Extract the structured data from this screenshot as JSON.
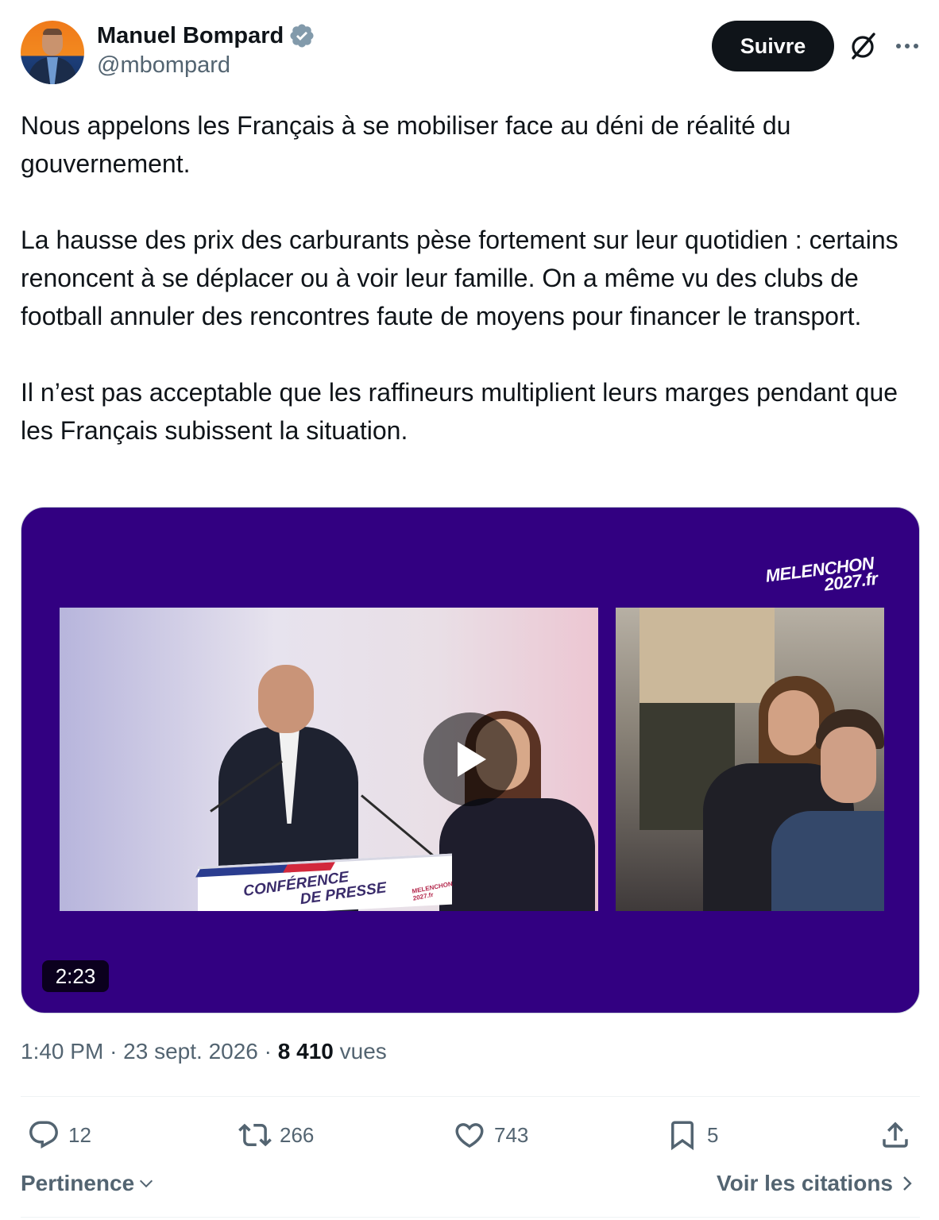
{
  "author": {
    "display_name": "Manuel Bompard",
    "handle": "@mbompard",
    "verified_icon": "verified-badge-icon",
    "verified_color": "#829aab"
  },
  "follow_label": "Suivre",
  "tweet": {
    "paragraphs": [
      "Nous appelons les Français à se mobiliser face au déni de réalité du gouvernement.",
      "La hausse des prix des carburants pèse fortement sur leur quotidien : certains renoncent à se déplacer ou à voir leur famille. On a même vu des clubs de football annuler des rencontres faute de moyens pour financer le transport.",
      "Il n’est pas acceptable que les raffineurs multiplient leurs marges pendant que les Français subissent la situation."
    ]
  },
  "media": {
    "background_color": "#320081",
    "brand_line1": "MELENCHON",
    "brand_line2": "2027.fr",
    "podium_line1": "CONFÉRENCE",
    "podium_line2": "DE PRESSE",
    "podium_brand_line1": "MELENCHON",
    "podium_brand_line2": "2027.fr",
    "duration": "2:23"
  },
  "meta": {
    "time": "1:40 PM",
    "separator": "·",
    "date": "23 sept. 2026",
    "views_count": "8 410",
    "views_label": "vues"
  },
  "actions": {
    "replies": "12",
    "reposts": "266",
    "likes": "743",
    "bookmarks": "5"
  },
  "footer": {
    "sort_label": "Pertinence",
    "quotes_label": "Voir les citations"
  }
}
